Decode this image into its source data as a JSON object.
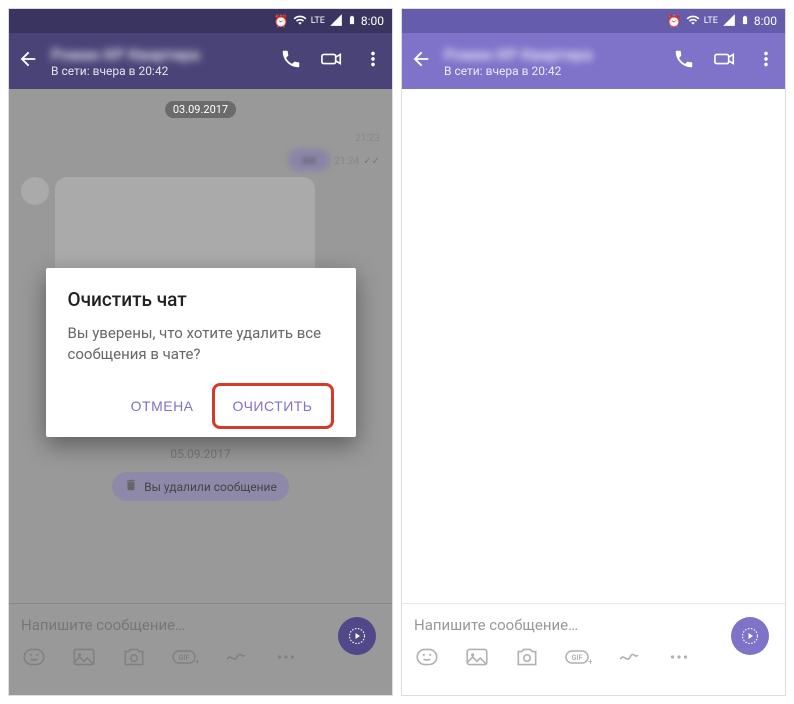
{
  "status": {
    "time": "8:00",
    "network": "LTE"
  },
  "header": {
    "contact": "Роман КР Квартира",
    "status": "В сети: вчера в 20:42"
  },
  "chat": {
    "date1": "03.09.2017",
    "time1": "21:23",
    "time2": "21:24",
    "date2": "05.09.2017",
    "deleted": "Вы удалили сообщение"
  },
  "input": {
    "placeholder": "Напишите сообщение…"
  },
  "dialog": {
    "title": "Очистить чат",
    "message": "Вы уверены, что хотите удалить все сообщения в чате?",
    "cancel": "ОТМЕНА",
    "confirm": "ОЧИСТИТЬ"
  }
}
